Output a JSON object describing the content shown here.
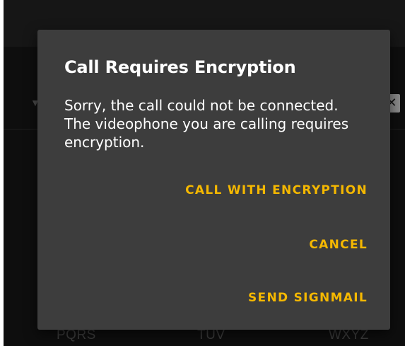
{
  "background": {
    "keypad_letters": [
      "PQRS",
      "TUV",
      "WXYZ"
    ],
    "chevron_icon": "chevron-down-icon",
    "clear_icon": "clear-input-icon",
    "clear_glyph": "✕"
  },
  "dialog": {
    "title": "Call Requires Encryption",
    "message": "Sorry, the call could not be connected. The videophone you are calling requires encryption.",
    "actions": {
      "call_with_encryption": "CALL WITH ENCRYPTION",
      "cancel": "CANCEL",
      "send_signmail": "SEND SIGNMAIL"
    }
  },
  "colors": {
    "accent": "#f5b800",
    "dialog_bg": "#3d3d3d",
    "screen_bg": "#0e0e0e"
  }
}
